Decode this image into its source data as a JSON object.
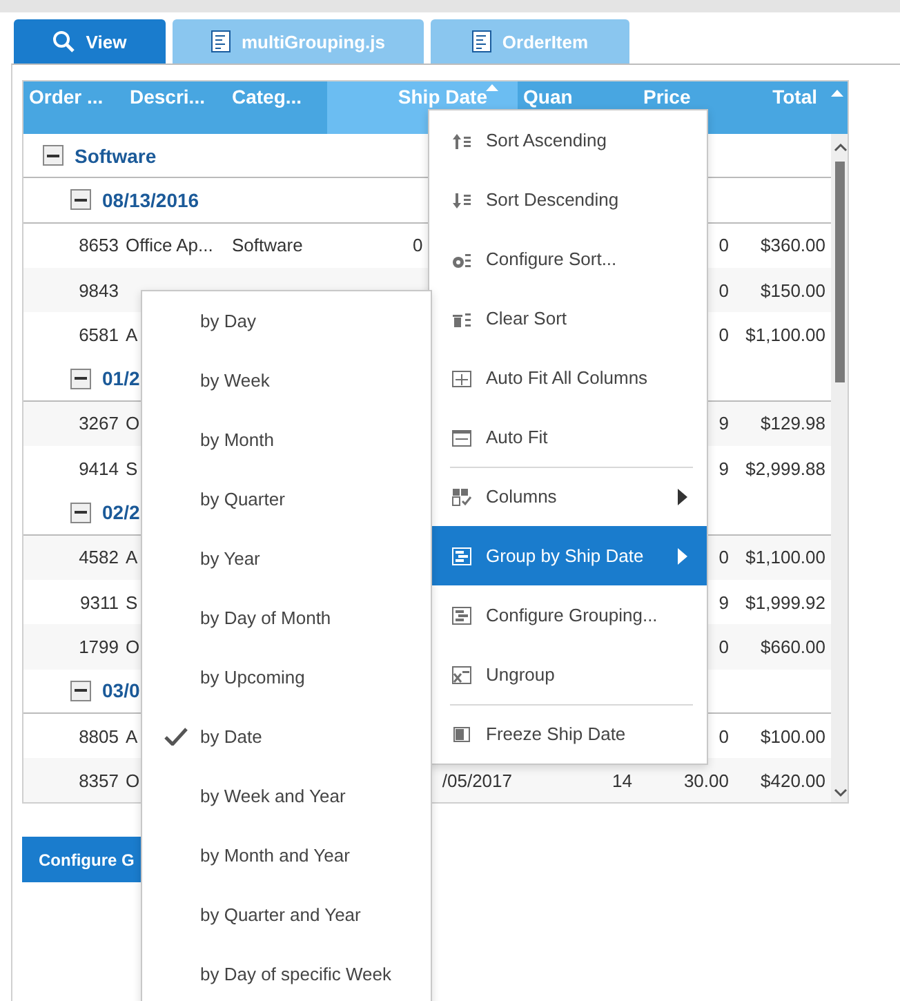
{
  "tabs": [
    {
      "label": "View",
      "kind": "search",
      "selected": true
    },
    {
      "label": "multiGrouping.js",
      "kind": "file",
      "selected": false
    },
    {
      "label": "OrderItem",
      "kind": "file",
      "selected": false
    }
  ],
  "grid": {
    "columns": [
      {
        "label": "Order ...",
        "highlighted": false,
        "sorted": false
      },
      {
        "label": "Descri...",
        "highlighted": false,
        "sorted": false
      },
      {
        "label": "Categ...",
        "highlighted": false,
        "sorted": false
      },
      {
        "label": "Ship Date",
        "highlighted": true,
        "sorted": true
      },
      {
        "label": "Quan",
        "highlighted": false,
        "sorted": false
      },
      {
        "label": "Price",
        "highlighted": false,
        "sorted": false
      },
      {
        "label": "Total",
        "highlighted": false,
        "sorted": false
      }
    ],
    "rows": [
      {
        "kind": "group",
        "label": "Software",
        "expanded": true,
        "children": [
          {
            "kind": "group",
            "label": "08/13/2016",
            "expanded": true,
            "children": [
              {
                "kind": "data",
                "order": "8653",
                "description": "Office Ap...",
                "category": "Software",
                "ship_date": "0",
                "price": "0",
                "total": "$360.00"
              },
              {
                "kind": "data",
                "order": "9843",
                "price": "0",
                "total": "$150.00"
              },
              {
                "kind": "data",
                "order": "6581",
                "description": "A",
                "price": "0",
                "total": "$1,100.00"
              }
            ]
          },
          {
            "kind": "group",
            "label": "01/2",
            "expanded": true,
            "children": [
              {
                "kind": "data",
                "order": "3267",
                "description": "O",
                "price": "9",
                "total": "$129.98"
              },
              {
                "kind": "data",
                "order": "9414",
                "description": "S",
                "price": "9",
                "total": "$2,999.88"
              }
            ]
          },
          {
            "kind": "group",
            "label": "02/2",
            "expanded": true,
            "children": [
              {
                "kind": "data",
                "order": "4582",
                "description": "A",
                "price": "0",
                "total": "$1,100.00"
              },
              {
                "kind": "data",
                "order": "9311",
                "description": "S",
                "price": "9",
                "total": "$1,999.92"
              },
              {
                "kind": "data",
                "order": "1799",
                "description": "O",
                "price": "0",
                "total": "$660.00"
              }
            ]
          },
          {
            "kind": "group",
            "label": "03/0",
            "expanded": true,
            "children": [
              {
                "kind": "data",
                "order": "8805",
                "description": "A",
                "price": "0",
                "total": "$100.00"
              },
              {
                "kind": "data",
                "order": "8357",
                "description": "O",
                "ship_date": "/05/2017",
                "quantity": "14",
                "price": "30.00",
                "total": "$420.00"
              }
            ]
          }
        ]
      }
    ]
  },
  "configure_button": "Configure G",
  "menu": {
    "items": [
      {
        "label": "Sort Ascending",
        "kind": "sort-ascending",
        "selected": false,
        "has_submenu": false,
        "separator_before": false
      },
      {
        "label": "Sort Descending",
        "kind": "sort-descending",
        "selected": false,
        "has_submenu": false,
        "separator_before": false
      },
      {
        "label": "Configure Sort...",
        "kind": "configure-sort",
        "selected": false,
        "has_submenu": false,
        "separator_before": false
      },
      {
        "label": "Clear Sort",
        "kind": "clear-sort",
        "selected": false,
        "has_submenu": false,
        "separator_before": false
      },
      {
        "label": "Auto Fit All Columns",
        "kind": "auto-fit-all",
        "selected": false,
        "has_submenu": false,
        "separator_before": false
      },
      {
        "label": "Auto Fit",
        "kind": "auto-fit",
        "selected": false,
        "has_submenu": false,
        "separator_before": false
      },
      {
        "label": "Columns",
        "kind": "columns",
        "selected": false,
        "has_submenu": true,
        "separator_before": true
      },
      {
        "label": "Group by Ship Date",
        "kind": "group",
        "selected": true,
        "has_submenu": true,
        "separator_before": false
      },
      {
        "label": "Configure Grouping...",
        "kind": "configure-grouping",
        "selected": false,
        "has_submenu": false,
        "separator_before": false
      },
      {
        "label": "Ungroup",
        "kind": "ungroup",
        "selected": false,
        "has_submenu": false,
        "separator_before": false
      },
      {
        "label": "Freeze Ship Date",
        "kind": "freeze",
        "selected": false,
        "has_submenu": false,
        "separator_before": true
      }
    ]
  },
  "submenu": {
    "items": [
      {
        "label": "by Day",
        "checked": false
      },
      {
        "label": "by Week",
        "checked": false
      },
      {
        "label": "by Month",
        "checked": false
      },
      {
        "label": "by Quarter",
        "checked": false
      },
      {
        "label": "by Year",
        "checked": false
      },
      {
        "label": "by Day of Month",
        "checked": false
      },
      {
        "label": "by Upcoming",
        "checked": false
      },
      {
        "label": "by Date",
        "checked": true
      },
      {
        "label": "by Week and Year",
        "checked": false
      },
      {
        "label": "by Month and Year",
        "checked": false
      },
      {
        "label": "by Quarter and Year",
        "checked": false
      },
      {
        "label": "by Day of specific Week",
        "checked": false
      }
    ]
  }
}
